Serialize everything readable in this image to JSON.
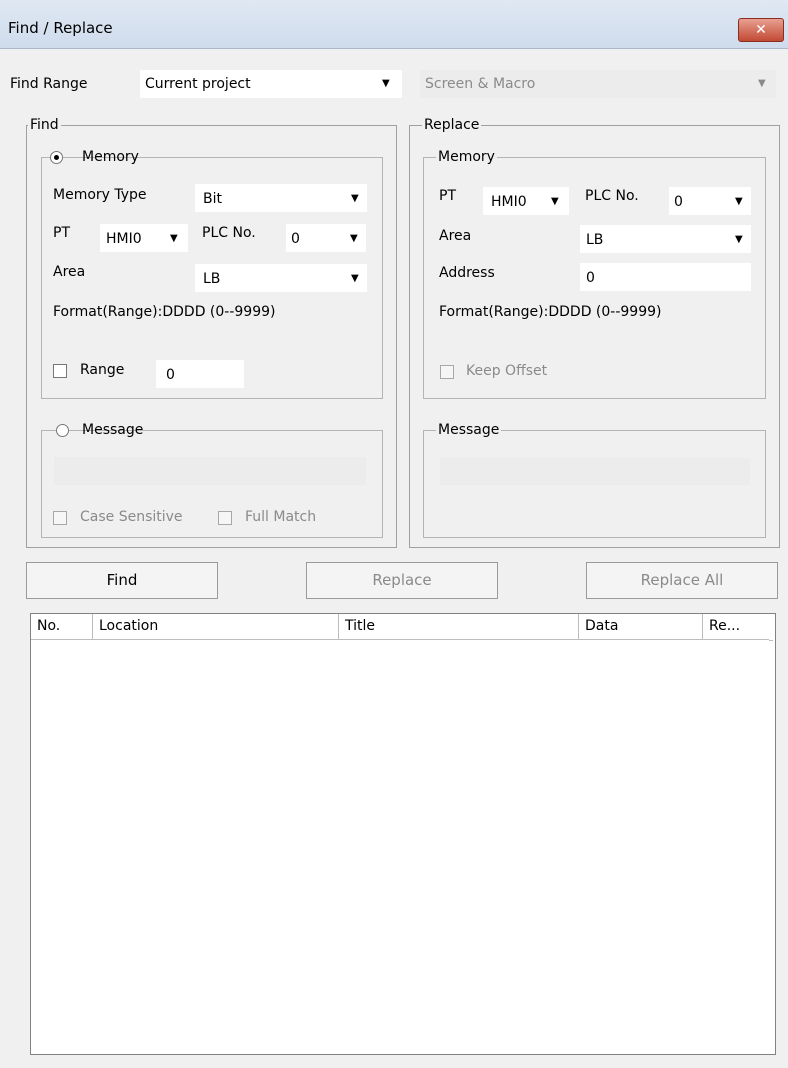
{
  "window": {
    "title": "Find / Replace",
    "close_glyph": "✕"
  },
  "find_range": {
    "label": "Find Range",
    "scope_value": "Current project",
    "target_value": "Screen & Macro"
  },
  "find": {
    "legend": "Find",
    "memory": {
      "legend": "Memory",
      "memory_type_label": "Memory Type",
      "memory_type_value": "Bit",
      "pt_label": "PT",
      "pt_value": "HMI0",
      "plc_label": "PLC No.",
      "plc_value": "0",
      "area_label": "Area",
      "area_value": "LB",
      "format_text": "Format(Range):DDDD (0--9999)",
      "range_label": "Range",
      "range_value": "0"
    },
    "message": {
      "legend": "Message",
      "case_sensitive_label": "Case Sensitive",
      "full_match_label": "Full Match"
    }
  },
  "replace": {
    "legend": "Replace",
    "memory": {
      "legend": "Memory",
      "pt_label": "PT",
      "pt_value": "HMI0",
      "plc_label": "PLC No.",
      "plc_value": "0",
      "area_label": "Area",
      "area_value": "LB",
      "address_label": "Address",
      "address_value": "0",
      "format_text": "Format(Range):DDDD (0--9999)",
      "keep_offset_label": "Keep Offset"
    },
    "message": {
      "legend": "Message"
    }
  },
  "buttons": {
    "find": "Find",
    "replace": "Replace",
    "replace_all": "Replace All"
  },
  "results": {
    "columns": {
      "no": "No.",
      "location": "Location",
      "title": "Title",
      "data": "Data",
      "re": "Re..."
    }
  },
  "icons": {
    "dropdown": "▼"
  },
  "colors": {
    "title_gradient_top": "#dfe8f3",
    "close_button": "#c24a34",
    "dialog_bg": "#f0f0f0"
  }
}
